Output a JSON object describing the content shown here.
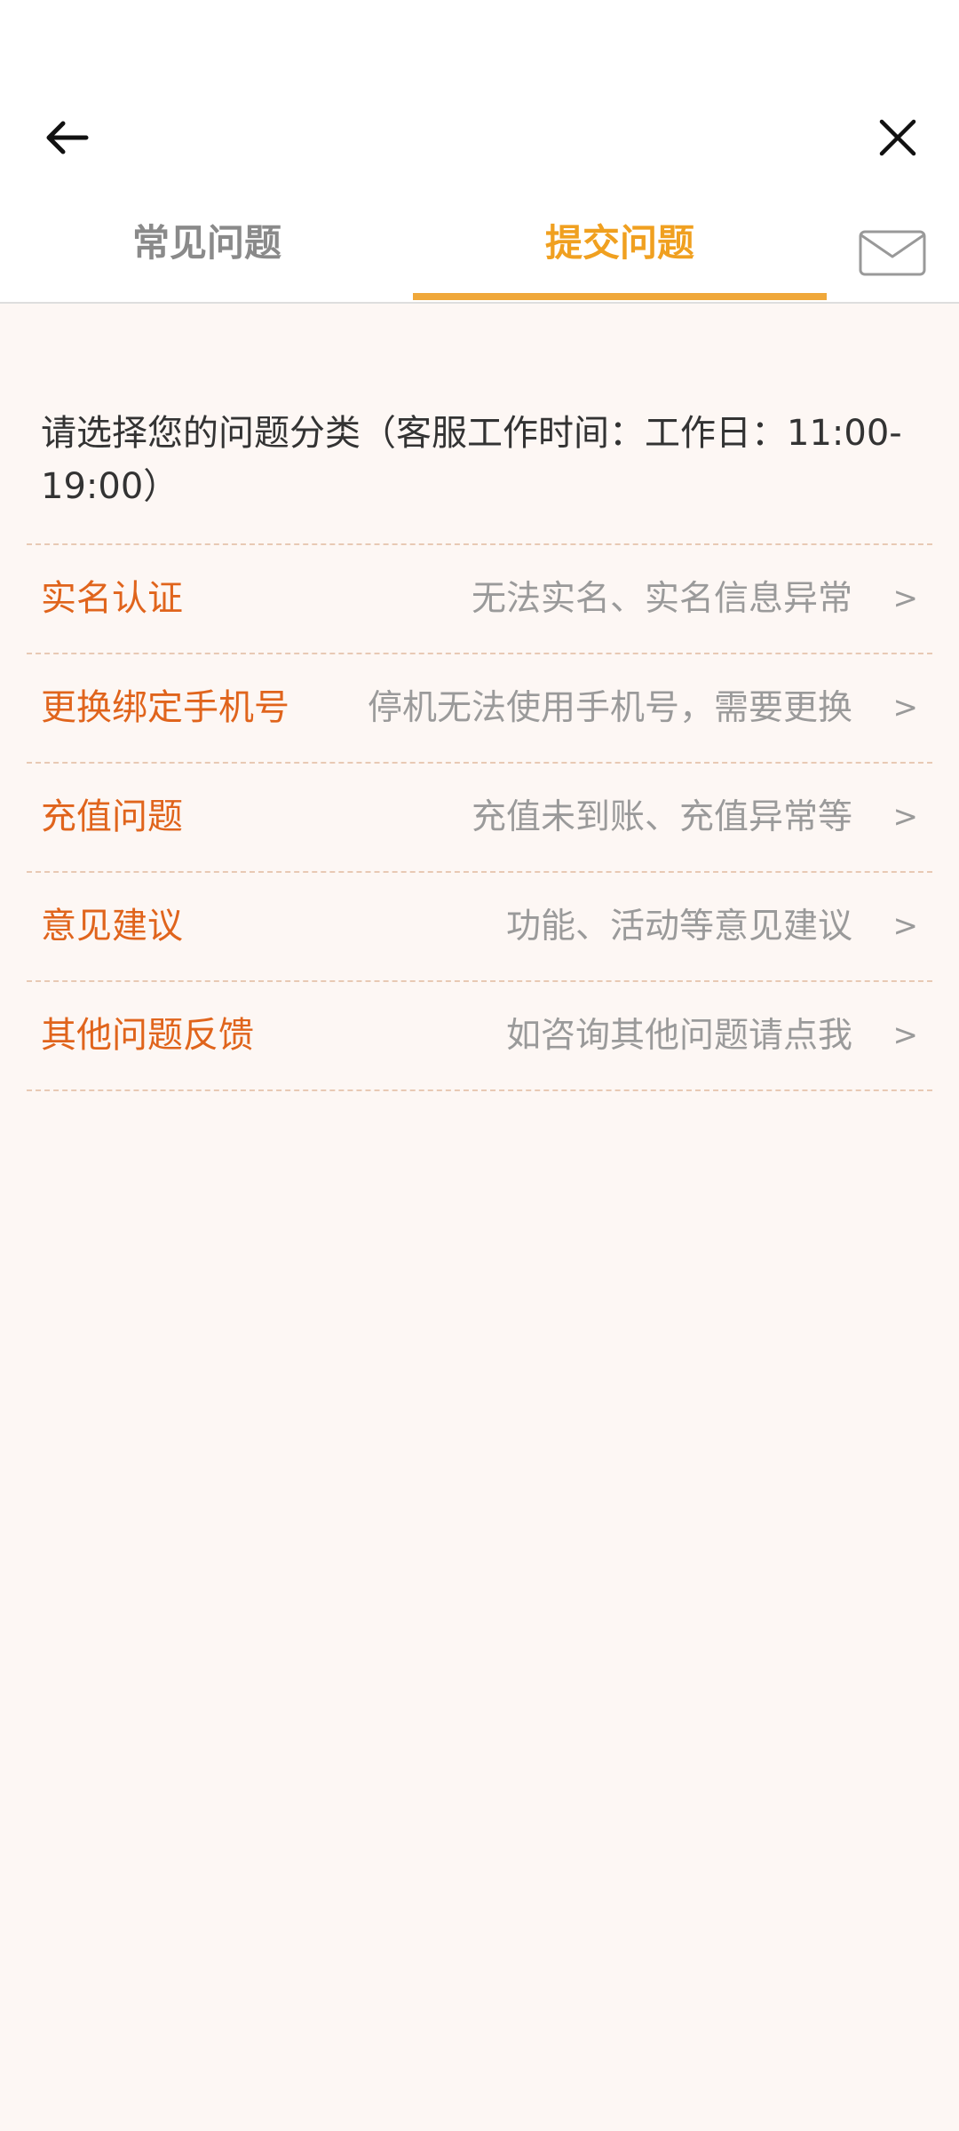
{
  "header": {
    "back_icon": "arrow-left-icon",
    "close_icon": "close-icon",
    "mail_icon": "envelope-icon"
  },
  "tabs": [
    {
      "label": "常见问题",
      "active": false
    },
    {
      "label": "提交问题",
      "active": true
    }
  ],
  "colors": {
    "accent": "#f0a83a",
    "item_title": "#e0641c",
    "description": "#9a9a9a",
    "background": "#fdf7f4"
  },
  "intro_text": "请选择您的问题分类（客服工作时间：工作日：11:00-19:00）",
  "categories": [
    {
      "title": "实名认证",
      "description": "无法实名、实名信息异常",
      "arrow": ">"
    },
    {
      "title": "更换绑定手机号",
      "description": "停机无法使用手机号，需要更换",
      "arrow": ">"
    },
    {
      "title": "充值问题",
      "description": "充值未到账、充值异常等",
      "arrow": ">"
    },
    {
      "title": "意见建议",
      "description": "功能、活动等意见建议",
      "arrow": ">"
    },
    {
      "title": "其他问题反馈",
      "description": "如咨询其他问题请点我",
      "arrow": ">"
    }
  ]
}
